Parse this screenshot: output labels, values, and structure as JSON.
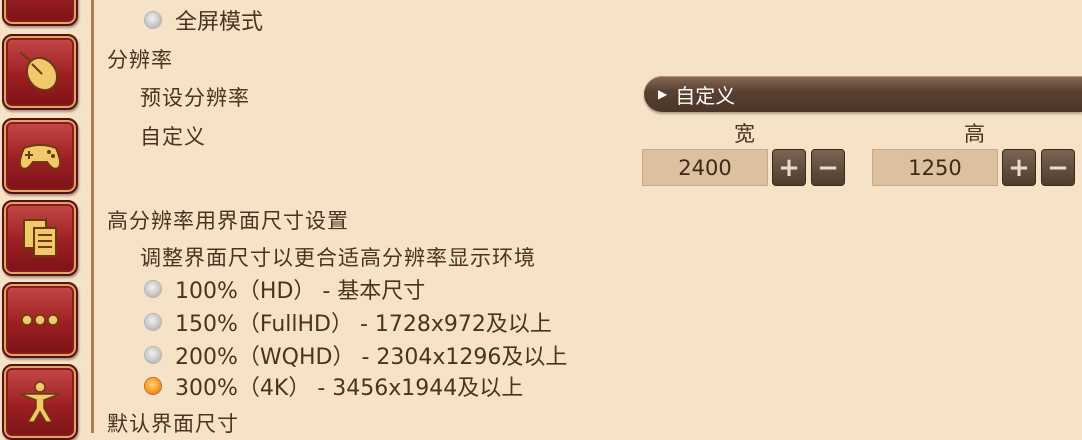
{
  "sidebar": {
    "buttons": [
      {
        "icon": "mouse-icon"
      },
      {
        "icon": "gamepad-icon"
      },
      {
        "icon": "documents-icon"
      },
      {
        "icon": "more-icon"
      },
      {
        "icon": "character-icon"
      }
    ]
  },
  "display_mode": {
    "fullscreen_label": "全屏模式"
  },
  "resolution": {
    "section_title": "分辨率",
    "preset_label": "预设分辨率",
    "preset_value": "自定义",
    "custom_label": "自定义",
    "width_header": "宽",
    "height_header": "高",
    "width_value": "2400",
    "height_value": "1250",
    "plus": "+",
    "minus": "−"
  },
  "ui_scale": {
    "section_title": "高分辨率用界面尺寸设置",
    "description": "调整界面尺寸以更合适高分辨率显示环境",
    "options": [
      {
        "label": "100%（HD）  - 基本尺寸",
        "selected": false
      },
      {
        "label": "150%（FullHD）  - 1728x972及以上",
        "selected": false
      },
      {
        "label": "200%（WQHD）  - 2304x1296及以上",
        "selected": false
      },
      {
        "label": "300%（4K）  - 3456x1944及以上",
        "selected": true
      }
    ]
  },
  "default_ui_size": {
    "section_title": "默认界面尺寸"
  },
  "colors": {
    "background": "#f6e3c7",
    "side_button": "#9c1f22",
    "selected_radio": "#f39c2a",
    "dropdown": "#5a4232"
  }
}
